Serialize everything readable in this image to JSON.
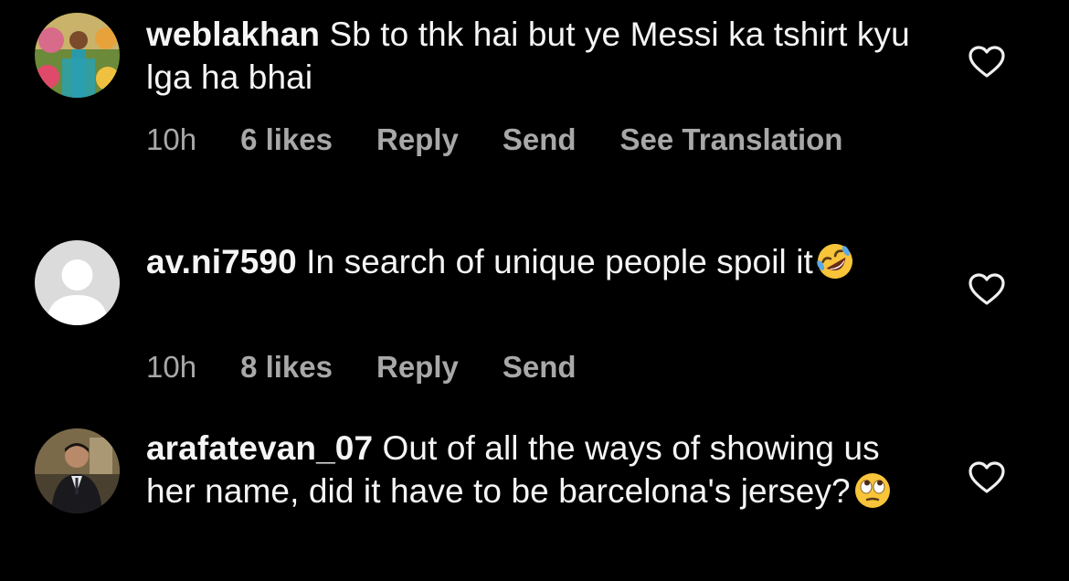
{
  "comments": [
    {
      "username": "weblakhan",
      "text": "Sb to thk hai but ye Messi ka tshirt kyu lga ha bhai",
      "time": "10h",
      "likes": "6 likes",
      "reply_label": "Reply",
      "send_label": "Send",
      "translate_label": "See Translation"
    },
    {
      "username": "av.ni7590",
      "text": "In search of unique people spoil it",
      "emoji": "rolling-on-floor-laughing-emoji",
      "time": "10h",
      "likes": "8 likes",
      "reply_label": "Reply",
      "send_label": "Send"
    },
    {
      "username": "arafatevan_07",
      "text": "Out of all the ways of showing us her name, did it have to be barcelona's jersey?",
      "emoji": "eye-roll-emoji"
    }
  ],
  "colors": {
    "background": "#000000",
    "primary_text": "#f5f5f5",
    "secondary_text": "#a8a8a8"
  },
  "icons": {
    "like": "heart-outline-icon"
  }
}
